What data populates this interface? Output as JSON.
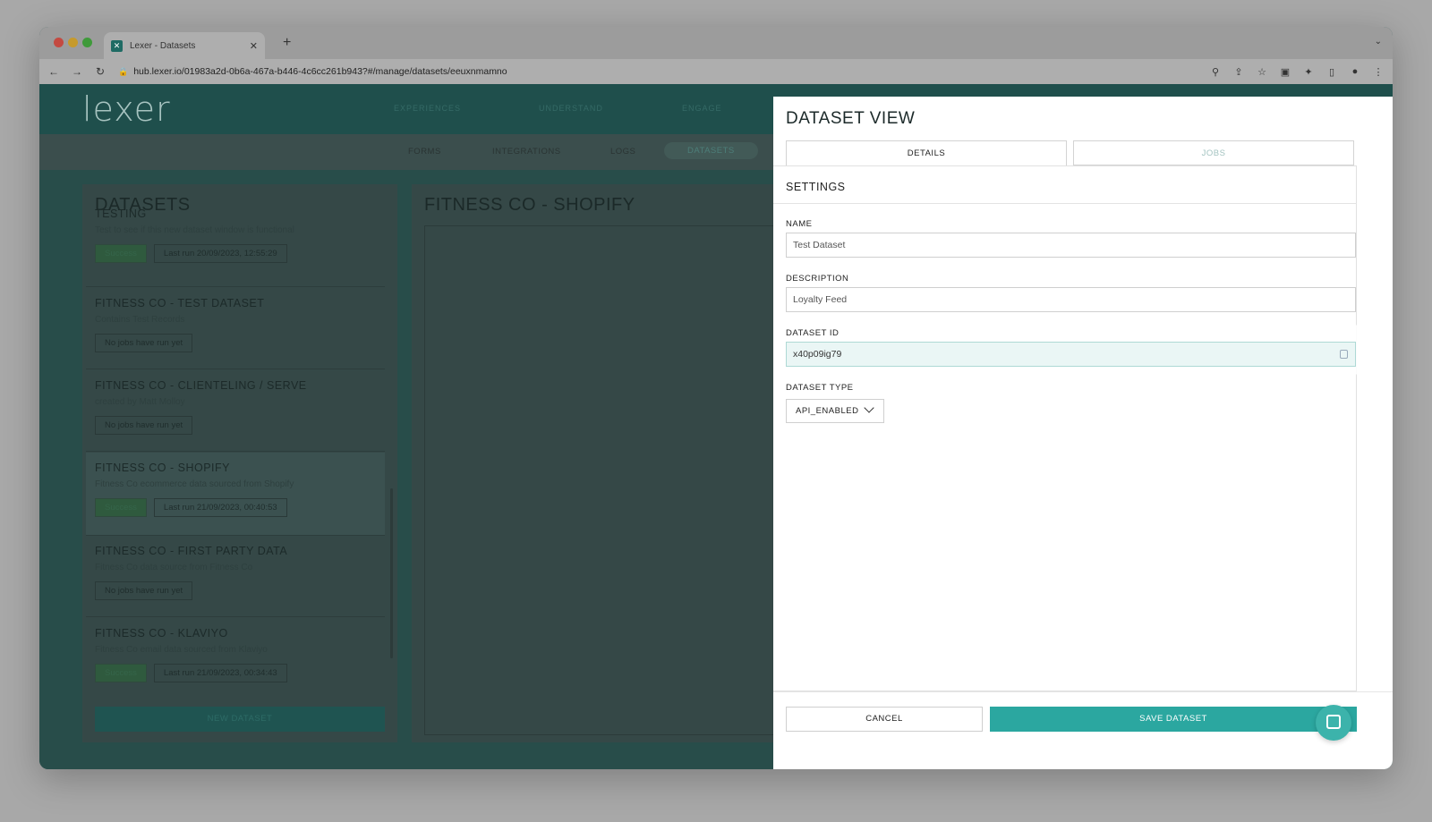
{
  "browser": {
    "tab_title": "Lexer - Datasets",
    "url": "hub.lexer.io/01983a2d-0b6a-467a-b446-4c6cc261b943?#/manage/datasets/eeuxnmamno"
  },
  "app": {
    "logo": "lexer",
    "main_nav": [
      "EXPERIENCES",
      "UNDERSTAND",
      "ENGAGE"
    ],
    "sub_nav": [
      "FORMS",
      "INTEGRATIONS",
      "LOGS",
      "DATASETS"
    ]
  },
  "datasets_panel": {
    "title": "DATASETS",
    "items": [
      {
        "name": "TESTING",
        "desc": "Test to see if this new dataset window is functional",
        "status": "Success",
        "run": "Last run 20/09/2023, 12:55:29"
      },
      {
        "name": "FITNESS CO - TEST DATASET",
        "desc": "Contains Test Records",
        "status": "",
        "run": "No jobs have run yet"
      },
      {
        "name": "FITNESS CO - CLIENTELING / SERVE",
        "desc": "created by Matt Molloy",
        "status": "",
        "run": "No jobs have run yet"
      },
      {
        "name": "FITNESS CO - SHOPIFY",
        "desc": "Fitness Co ecommerce data sourced from Shopify",
        "status": "Success",
        "run": "Last run 21/09/2023, 00:40:53"
      },
      {
        "name": "FITNESS CO - FIRST PARTY DATA",
        "desc": "Fitness Co data source from Fitness Co",
        "status": "",
        "run": "No jobs have run yet"
      },
      {
        "name": "FITNESS CO - KLAVIYO",
        "desc": "Fitness Co email data sourced from Klaviyo",
        "status": "Success",
        "run": "Last run 21/09/2023, 00:34:43"
      }
    ],
    "new_button": "NEW DATASET"
  },
  "detail_panel": {
    "title": "FITNESS CO - SHOPIFY"
  },
  "dataset_view": {
    "title": "DATASET VIEW",
    "tabs": [
      "DETAILS",
      "JOBS"
    ],
    "section": "SETTINGS",
    "name_label": "NAME",
    "name_value": "Test Dataset",
    "description_label": "DESCRIPTION",
    "description_value": "Loyalty Feed",
    "id_label": "DATASET ID",
    "id_value": "x40p09ig79",
    "type_label": "DATASET TYPE",
    "type_value": "API_ENABLED",
    "cancel": "CANCEL",
    "save": "SAVE DATASET"
  },
  "icons": [
    "close-icon",
    "plus-icon",
    "back-icon",
    "forward-icon",
    "reload-icon",
    "lock-icon",
    "zoom-icon",
    "share-icon",
    "star-icon",
    "extension-icon",
    "puzzle-icon",
    "sidebar-icon",
    "profile-icon",
    "kebab-icon",
    "copy-icon",
    "chevron-down-icon",
    "chat-icon"
  ],
  "colors": {
    "accent": "#2ba7a0",
    "app_header": "#1f4f4c"
  }
}
